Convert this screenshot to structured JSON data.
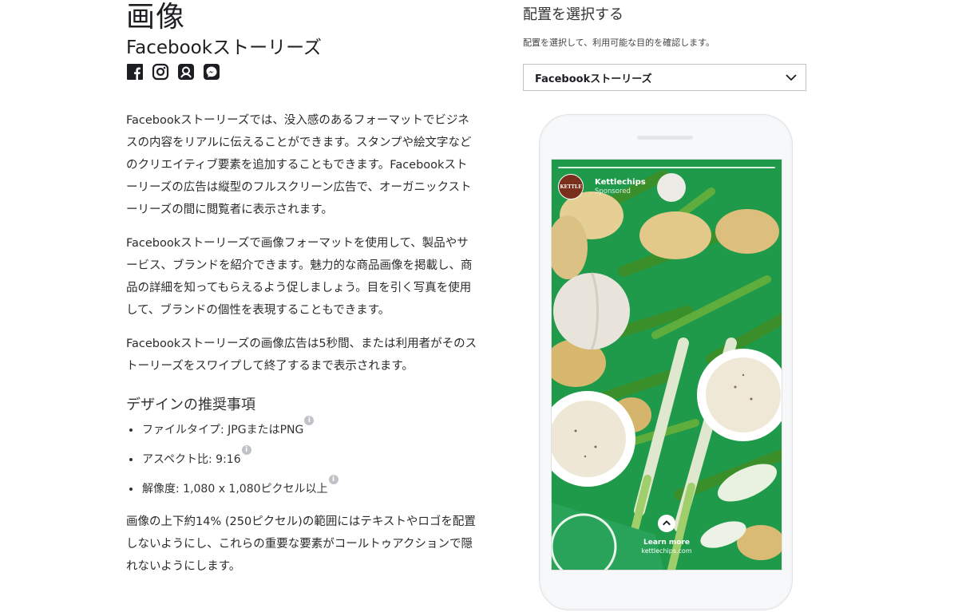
{
  "page": {
    "title": "画像",
    "subtitle": "Facebookストーリーズ",
    "platform_icons": [
      "facebook-icon",
      "instagram-icon",
      "audience-network-icon",
      "messenger-icon"
    ]
  },
  "description": {
    "p1": "Facebookストーリーズでは、没入感のあるフォーマットでビジネスの内容をリアルに伝えることができます。スタンプや絵文字などのクリエイティブ要素を追加することもできます。Facebookストーリーズの広告は縦型のフルスクリーン広告で、オーガニックストーリーズの間に閲覧者に表示されます。",
    "p2": "Facebookストーリーズで画像フォーマットを使用して、製品やサービス、ブランドを紹介できます。魅力的な商品画像を掲載し、商品の詳細を知ってもらえるよう促しましょう。目を引く写真を使用して、ブランドの個性を表現することもできます。",
    "p3": "Facebookストーリーズの画像広告は5秒間、または利用者がそのストーリーズをスワイプして終了するまで表示されます。"
  },
  "recommendations": {
    "title": "デザインの推奨事項",
    "items": [
      {
        "label": "ファイルタイプ: JPGまたはPNG",
        "info": "i"
      },
      {
        "label": "アスペクト比: 9:16",
        "info": "i"
      },
      {
        "label": "解像度: 1,080 x 1,080ピクセル以上",
        "info": "i"
      }
    ],
    "note": "画像の上下約14% (250ピクセル)の範囲にはテキストやロゴを配置しないようにし、これらの重要な要素がコールトゥアクションで隠れないようにします。"
  },
  "placement": {
    "heading": "配置を選択する",
    "subtext": "配置を選択して、利用可能な目的を確認します。",
    "selected": "Facebookストーリーズ"
  },
  "preview": {
    "brand_logo": "KETTLE",
    "brand_name": "Kettlechips",
    "sponsored": "Sponsored",
    "cta_label": "Learn more",
    "cta_url": "kettlechips.com"
  },
  "colors": {
    "text": "#1c1e21",
    "facebook_blue": "#1c1e21",
    "ad_green": "#1f9a4a"
  }
}
